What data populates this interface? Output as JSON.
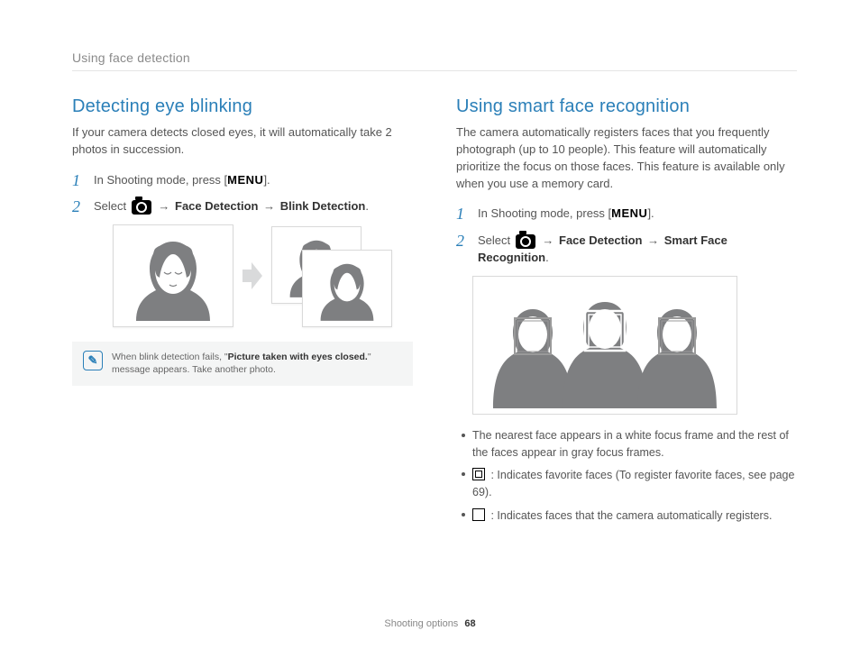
{
  "header": {
    "section": "Using face detection"
  },
  "left": {
    "title": "Detecting eye blinking",
    "intro": "If your camera detects closed eyes, it will automatically take 2 photos in succession.",
    "step1_prefix": "In Shooting mode, press [",
    "menu_label": "MENU",
    "step1_suffix": "].",
    "step2_prefix": "Select ",
    "arrow": "→",
    "fd": "Face Detection",
    "bd": "Blink Detection",
    "note_prefix": "When blink detection fails, \"",
    "note_bold": "Picture taken with eyes closed.",
    "note_suffix": "\" message appears. Take another photo."
  },
  "right": {
    "title": "Using smart face recognition",
    "intro": "The camera automatically registers faces that you frequently photograph (up to 10 people). This feature will automatically prioritize the focus on those faces. This feature is available only when you use a memory card.",
    "step1_prefix": "In Shooting mode, press [",
    "menu_label": "MENU",
    "step1_suffix": "].",
    "step2_prefix": "Select ",
    "arrow": "→",
    "fd": "Face Detection",
    "sfr": "Smart Face Recognition",
    "b1": "The nearest face appears in a white focus frame and the rest of the faces appear in gray focus frames.",
    "b2": " : Indicates favorite faces (To register favorite faces, see page 69).",
    "b3": " : Indicates faces that the camera automatically registers."
  },
  "footer": {
    "label": "Shooting options",
    "page": "68"
  },
  "icons": {
    "camera": "camera-icon",
    "note": "note-icon",
    "frame_double": "double-frame-icon",
    "frame_single": "single-frame-icon"
  }
}
